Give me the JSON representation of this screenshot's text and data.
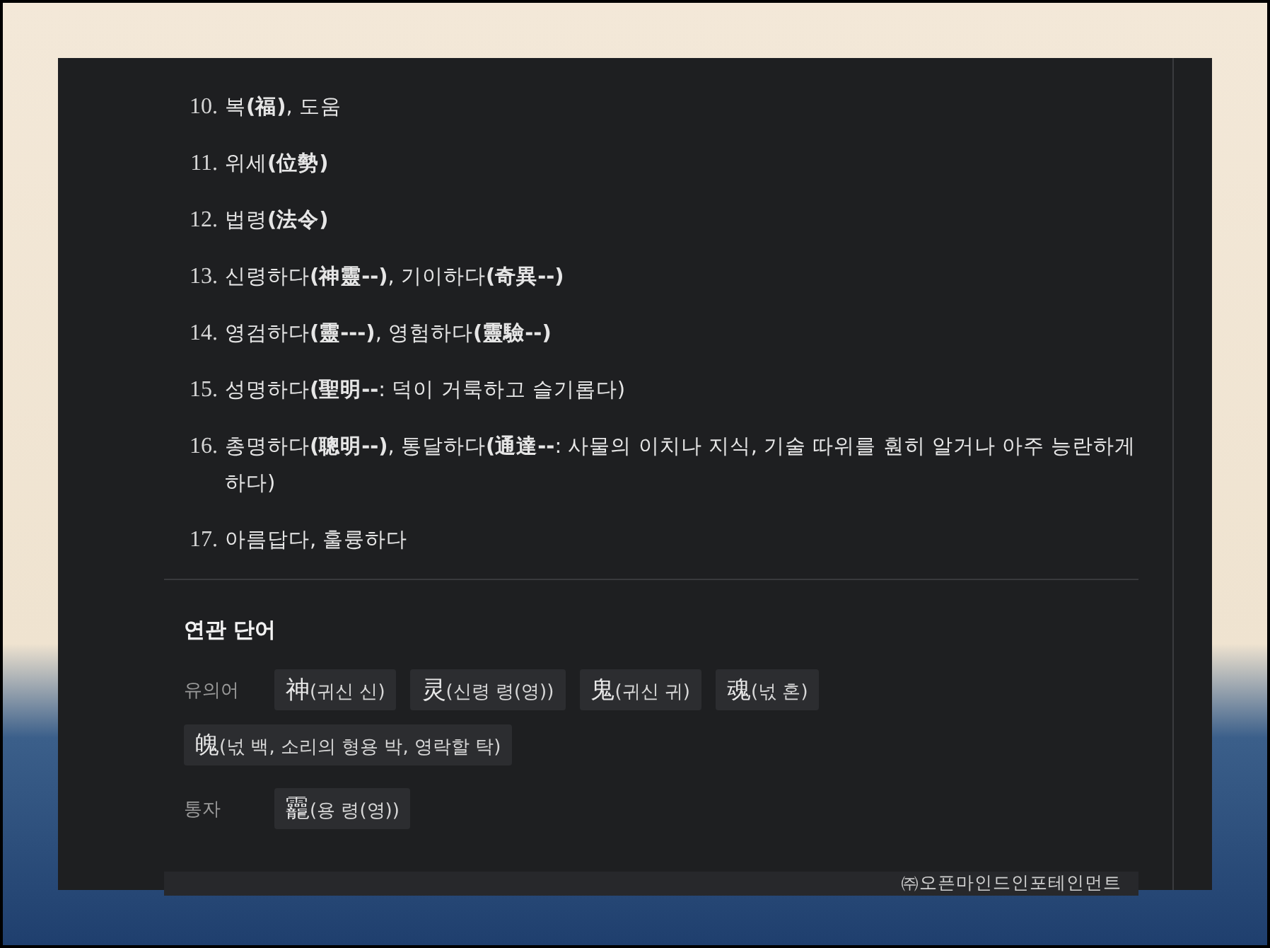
{
  "meanings": [
    {
      "number": "10.",
      "text": "복**(福)**, 도움"
    },
    {
      "number": "11.",
      "text": "위세**(位勢)**"
    },
    {
      "number": "12.",
      "text": "법령**(法令)**"
    },
    {
      "number": "13.",
      "text": "신령하다**(神靈--)**, 기이하다**(奇異--)**"
    },
    {
      "number": "14.",
      "text": "영검하다**(靈---)**, 영험하다**(靈驗--)**"
    },
    {
      "number": "15.",
      "text": "성명하다**(聖明--**: 덕이 거룩하고 슬기롭다)"
    },
    {
      "number": "16.",
      "text": "총명하다**(聰明--)**, 통달하다**(通達--**: 사물의 이치나 지식, 기술 따위를 훤히 알거나 아주 능란하게 하다)"
    },
    {
      "number": "17.",
      "text": "아름답다, 훌륭하다"
    }
  ],
  "related": {
    "title": "연관 단어",
    "groups": [
      {
        "label": "유의어",
        "words": [
          {
            "hanja": "神",
            "reading": "(귀신 신)"
          },
          {
            "hanja": "灵",
            "reading": "(신령 령(영))"
          },
          {
            "hanja": "鬼",
            "reading": "(귀신 귀)"
          },
          {
            "hanja": "魂",
            "reading": "(넋 혼)"
          },
          {
            "hanja": "魄",
            "reading": "(넋 백, 소리의 형용 박, 영락할 탁)"
          }
        ]
      },
      {
        "label": "통자",
        "words": [
          {
            "hanja": "龗",
            "reading": "(용 령(영))"
          }
        ]
      }
    ]
  },
  "footer": {
    "copyright": "㈜오픈마인드인포테인먼트"
  }
}
